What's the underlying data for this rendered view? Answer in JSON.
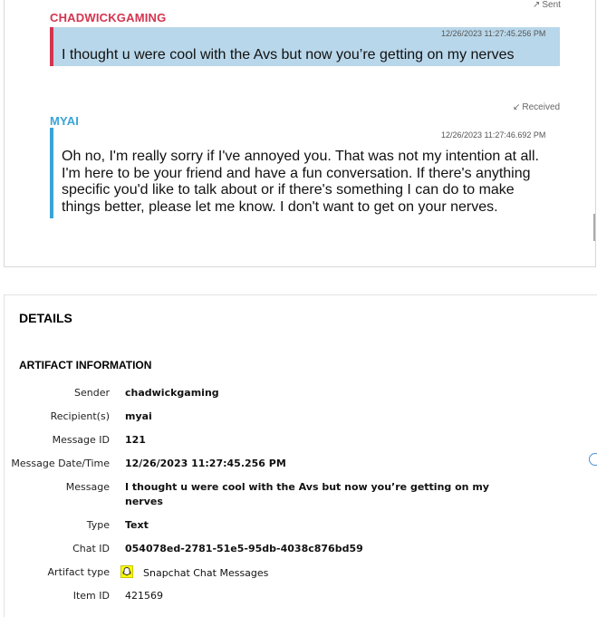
{
  "messages": [
    {
      "direction_label": "Sent",
      "direction_arrow": "↗",
      "sender": "CHADWICKGAMING",
      "timestamp": "12/26/2023 11:27:45.256 PM",
      "text": "I thought u were cool with the Avs but now you’re getting on my nerves",
      "accent_color": "#d4344f",
      "bubble_color": "#b9d7ea"
    },
    {
      "direction_label": "Received",
      "direction_arrow": "↙",
      "sender": "MYAI",
      "timestamp": "12/26/2023 11:27:46.692 PM",
      "text": "Oh no, I'm really sorry if I've annoyed you. That was not my intention at all.\nI'm here to be your friend and have a fun conversation. If there's anything\nspecific you'd like to talk about or if there's something I can do to make\nthings better, please let me know. I don't want to get on your nerves.",
      "accent_color": "#3aa4d6",
      "bubble_color": "#ffffff"
    }
  ],
  "details": {
    "title": "DETAILS",
    "section": "ARTIFACT INFORMATION",
    "rows": [
      {
        "label": "Sender",
        "value": "chadwickgaming"
      },
      {
        "label": "Recipient(s)",
        "value": "myai"
      },
      {
        "label": "Message ID",
        "value": "121"
      },
      {
        "label": "Message Date/Time",
        "value": "12/26/2023 11:27:45.256 PM"
      },
      {
        "label": "Message",
        "value": "I thought u were cool with the Avs but now you’re getting on my\nnerves"
      },
      {
        "label": "Type",
        "value": "Text"
      },
      {
        "label": "Chat ID",
        "value": "054078ed-2781-51e5-95db-4038c876bd59"
      },
      {
        "label": "Artifact type",
        "value": "Snapchat Chat Messages",
        "icon": "snapchat-ghost-icon"
      },
      {
        "label": "Item ID",
        "value": "421569"
      }
    ]
  }
}
